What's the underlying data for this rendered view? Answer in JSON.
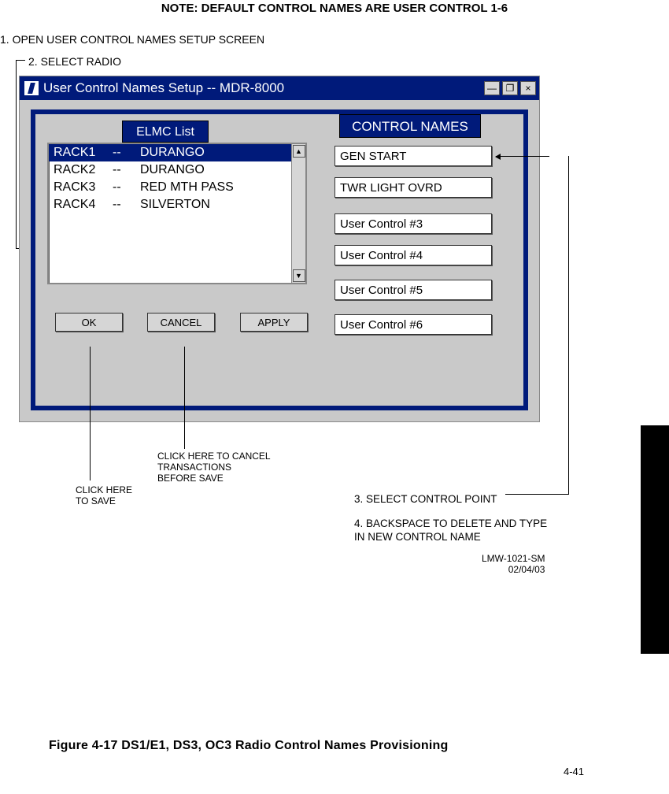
{
  "note": "NOTE: DEFAULT CONTROL NAMES ARE USER CONTROL 1-6",
  "steps": {
    "s1": "1. OPEN USER CONTROL NAMES SETUP SCREEN",
    "s2": "2. SELECT RADIO",
    "s3": "3. SELECT CONTROL POINT",
    "s4": "4. BACKSPACE TO DELETE AND TYPE IN NEW CONTROL NAME"
  },
  "dialog": {
    "title": "User Control Names Setup  --  MDR-8000",
    "elmc_header": "ELMC List",
    "control_names_header": "CONTROL NAMES",
    "list": [
      {
        "c1": "RACK1",
        "c2": "--",
        "c3": "DURANGO",
        "selected": true
      },
      {
        "c1": "RACK2",
        "c2": "--",
        "c3": "DURANGO",
        "selected": false
      },
      {
        "c1": "RACK3",
        "c2": "--",
        "c3": "RED MTH PASS",
        "selected": false
      },
      {
        "c1": "RACK4",
        "c2": "--",
        "c3": "SILVERTON",
        "selected": false
      }
    ],
    "controls": [
      "GEN START",
      "TWR LIGHT OVRD",
      "User Control #3",
      "User Control #4",
      "User Control #5",
      "User Control #6"
    ],
    "buttons": {
      "ok": "OK",
      "cancel": "CANCEL",
      "apply": "APPLY"
    }
  },
  "callouts": {
    "ok": "CLICK HERE\nTO SAVE",
    "cancel": "CLICK HERE TO CANCEL\nTRANSACTIONS\nBEFORE SAVE"
  },
  "docid": {
    "a": "LMW-1021-SM",
    "b": "02/04/03"
  },
  "figure": "Figure 4-17  DS1/E1, DS3, OC3 Radio Control Names Provisioning",
  "pagenum": "4-41"
}
